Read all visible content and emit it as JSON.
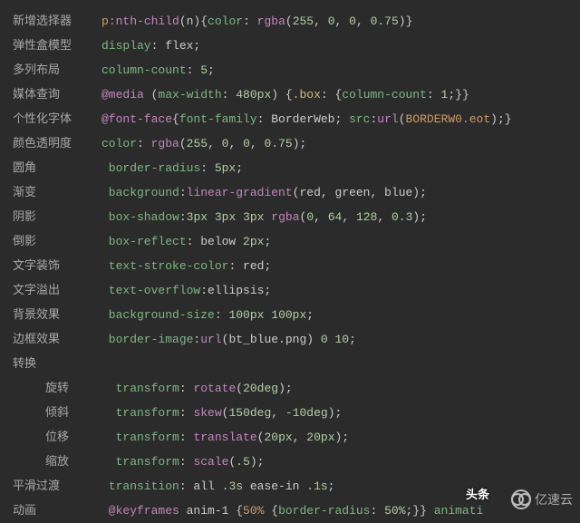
{
  "lines": [
    {
      "label": "新增选择器",
      "indent": false,
      "tokens": [
        {
          "t": "p",
          "c": "c-orange"
        },
        {
          "t": ":nth-child",
          "c": "c-pink"
        },
        {
          "t": "(n){",
          "c": "c-default"
        },
        {
          "t": "color",
          "c": "c-prop"
        },
        {
          "t": ": ",
          "c": "c-default"
        },
        {
          "t": "rgba",
          "c": "c-pink"
        },
        {
          "t": "(",
          "c": "c-default"
        },
        {
          "t": "255",
          "c": "c-num"
        },
        {
          "t": ", ",
          "c": "c-default"
        },
        {
          "t": "0",
          "c": "c-num"
        },
        {
          "t": ", ",
          "c": "c-default"
        },
        {
          "t": "0",
          "c": "c-num"
        },
        {
          "t": ", ",
          "c": "c-default"
        },
        {
          "t": "0.75",
          "c": "c-num"
        },
        {
          "t": ")}",
          "c": "c-default"
        }
      ]
    },
    {
      "label": "弹性盒模型",
      "indent": false,
      "tokens": [
        {
          "t": "display",
          "c": "c-prop"
        },
        {
          "t": ": flex;",
          "c": "c-default"
        }
      ]
    },
    {
      "label": "多列布局",
      "indent": false,
      "tokens": [
        {
          "t": "column-count",
          "c": "c-prop"
        },
        {
          "t": ": ",
          "c": "c-default"
        },
        {
          "t": "5",
          "c": "c-num"
        },
        {
          "t": ";",
          "c": "c-default"
        }
      ]
    },
    {
      "label": "媒体查询",
      "indent": false,
      "tokens": [
        {
          "t": "@media",
          "c": "c-pink"
        },
        {
          "t": " (",
          "c": "c-default"
        },
        {
          "t": "max-width",
          "c": "c-prop"
        },
        {
          "t": ": ",
          "c": "c-default"
        },
        {
          "t": "480px",
          "c": "c-num"
        },
        {
          "t": ") {",
          "c": "c-default"
        },
        {
          "t": ".box",
          "c": "c-yellow"
        },
        {
          "t": ": {",
          "c": "c-default"
        },
        {
          "t": "column-count",
          "c": "c-prop"
        },
        {
          "t": ": ",
          "c": "c-default"
        },
        {
          "t": "1",
          "c": "c-num"
        },
        {
          "t": ";}}",
          "c": "c-default"
        }
      ]
    },
    {
      "label": "个性化字体",
      "indent": false,
      "tokens": [
        {
          "t": "@font-face",
          "c": "c-pink"
        },
        {
          "t": "{",
          "c": "c-default"
        },
        {
          "t": "font-family",
          "c": "c-prop"
        },
        {
          "t": ": BorderWeb; ",
          "c": "c-default"
        },
        {
          "t": "src",
          "c": "c-prop"
        },
        {
          "t": ":",
          "c": "c-default"
        },
        {
          "t": "url",
          "c": "c-pink"
        },
        {
          "t": "(",
          "c": "c-default"
        },
        {
          "t": "BORDERW0.eot",
          "c": "c-orange"
        },
        {
          "t": ");}",
          "c": "c-default"
        }
      ]
    },
    {
      "label": "颜色透明度",
      "indent": false,
      "tokens": [
        {
          "t": "color",
          "c": "c-prop"
        },
        {
          "t": ": ",
          "c": "c-default"
        },
        {
          "t": "rgba",
          "c": "c-pink"
        },
        {
          "t": "(",
          "c": "c-default"
        },
        {
          "t": "255",
          "c": "c-num"
        },
        {
          "t": ", ",
          "c": "c-default"
        },
        {
          "t": "0",
          "c": "c-num"
        },
        {
          "t": ", ",
          "c": "c-default"
        },
        {
          "t": "0",
          "c": "c-num"
        },
        {
          "t": ", ",
          "c": "c-default"
        },
        {
          "t": "0.75",
          "c": "c-num"
        },
        {
          "t": ");",
          "c": "c-default"
        }
      ]
    },
    {
      "label": "圆角",
      "indent": false,
      "tokens": [
        {
          "t": " border-radius",
          "c": "c-prop"
        },
        {
          "t": ": ",
          "c": "c-default"
        },
        {
          "t": "5px",
          "c": "c-num"
        },
        {
          "t": ";",
          "c": "c-default"
        }
      ]
    },
    {
      "label": "渐变",
      "indent": false,
      "tokens": [
        {
          "t": " background",
          "c": "c-prop"
        },
        {
          "t": ":",
          "c": "c-default"
        },
        {
          "t": "linear-gradient",
          "c": "c-pink"
        },
        {
          "t": "(red, green, blue);",
          "c": "c-default"
        }
      ]
    },
    {
      "label": "阴影",
      "indent": false,
      "tokens": [
        {
          "t": " box-shadow",
          "c": "c-prop"
        },
        {
          "t": ":",
          "c": "c-default"
        },
        {
          "t": "3px",
          "c": "c-num"
        },
        {
          "t": " ",
          "c": "c-default"
        },
        {
          "t": "3px",
          "c": "c-num"
        },
        {
          "t": " ",
          "c": "c-default"
        },
        {
          "t": "3px",
          "c": "c-num"
        },
        {
          "t": " ",
          "c": "c-default"
        },
        {
          "t": "rgba",
          "c": "c-pink"
        },
        {
          "t": "(",
          "c": "c-default"
        },
        {
          "t": "0",
          "c": "c-num"
        },
        {
          "t": ", ",
          "c": "c-default"
        },
        {
          "t": "64",
          "c": "c-num"
        },
        {
          "t": ", ",
          "c": "c-default"
        },
        {
          "t": "128",
          "c": "c-num"
        },
        {
          "t": ", ",
          "c": "c-default"
        },
        {
          "t": "0.3",
          "c": "c-num"
        },
        {
          "t": ");",
          "c": "c-default"
        }
      ]
    },
    {
      "label": "倒影",
      "indent": false,
      "tokens": [
        {
          "t": " box-reflect",
          "c": "c-prop"
        },
        {
          "t": ": below ",
          "c": "c-default"
        },
        {
          "t": "2px",
          "c": "c-num"
        },
        {
          "t": ";",
          "c": "c-default"
        }
      ]
    },
    {
      "label": "文字装饰",
      "indent": false,
      "tokens": [
        {
          "t": " text-stroke-color",
          "c": "c-prop"
        },
        {
          "t": ": red;",
          "c": "c-default"
        }
      ]
    },
    {
      "label": "文字溢出",
      "indent": false,
      "tokens": [
        {
          "t": " text-overflow",
          "c": "c-prop"
        },
        {
          "t": ":ellipsis;",
          "c": "c-default"
        }
      ]
    },
    {
      "label": "背景效果",
      "indent": false,
      "tokens": [
        {
          "t": " background-size",
          "c": "c-prop"
        },
        {
          "t": ": ",
          "c": "c-default"
        },
        {
          "t": "100px",
          "c": "c-num"
        },
        {
          "t": " ",
          "c": "c-default"
        },
        {
          "t": "100px",
          "c": "c-num"
        },
        {
          "t": ";",
          "c": "c-default"
        }
      ]
    },
    {
      "label": "边框效果",
      "indent": false,
      "tokens": [
        {
          "t": " border-image",
          "c": "c-prop"
        },
        {
          "t": ":",
          "c": "c-default"
        },
        {
          "t": "url",
          "c": "c-pink"
        },
        {
          "t": "(bt_blue.png) ",
          "c": "c-default"
        },
        {
          "t": "0",
          "c": "c-num"
        },
        {
          "t": " ",
          "c": "c-default"
        },
        {
          "t": "10",
          "c": "c-num"
        },
        {
          "t": ";",
          "c": "c-default"
        }
      ]
    },
    {
      "label": "转换",
      "indent": false,
      "tokens": []
    },
    {
      "label": "旋转",
      "indent": true,
      "tokens": [
        {
          "t": "  transform",
          "c": "c-prop"
        },
        {
          "t": ": ",
          "c": "c-default"
        },
        {
          "t": "rotate",
          "c": "c-pink"
        },
        {
          "t": "(",
          "c": "c-default"
        },
        {
          "t": "20deg",
          "c": "c-num"
        },
        {
          "t": ");",
          "c": "c-default"
        }
      ]
    },
    {
      "label": "倾斜",
      "indent": true,
      "tokens": [
        {
          "t": "  transform",
          "c": "c-prop"
        },
        {
          "t": ": ",
          "c": "c-default"
        },
        {
          "t": "skew",
          "c": "c-pink"
        },
        {
          "t": "(",
          "c": "c-default"
        },
        {
          "t": "150deg",
          "c": "c-num"
        },
        {
          "t": ", ",
          "c": "c-default"
        },
        {
          "t": "-10deg",
          "c": "c-num"
        },
        {
          "t": ");",
          "c": "c-default"
        }
      ]
    },
    {
      "label": "位移",
      "indent": true,
      "tokens": [
        {
          "t": "  transform",
          "c": "c-prop"
        },
        {
          "t": ": ",
          "c": "c-default"
        },
        {
          "t": "translate",
          "c": "c-pink"
        },
        {
          "t": "(",
          "c": "c-default"
        },
        {
          "t": "20px",
          "c": "c-num"
        },
        {
          "t": ", ",
          "c": "c-default"
        },
        {
          "t": "20px",
          "c": "c-num"
        },
        {
          "t": ");",
          "c": "c-default"
        }
      ]
    },
    {
      "label": "缩放",
      "indent": true,
      "tokens": [
        {
          "t": "  transform",
          "c": "c-prop"
        },
        {
          "t": ": ",
          "c": "c-default"
        },
        {
          "t": "scale",
          "c": "c-pink"
        },
        {
          "t": "(",
          "c": "c-default"
        },
        {
          "t": ".5",
          "c": "c-num"
        },
        {
          "t": ");",
          "c": "c-default"
        }
      ]
    },
    {
      "label": "平滑过渡",
      "indent": false,
      "tokens": [
        {
          "t": " transition",
          "c": "c-prop"
        },
        {
          "t": ": all ",
          "c": "c-default"
        },
        {
          "t": ".3s",
          "c": "c-num"
        },
        {
          "t": " ease-in ",
          "c": "c-default"
        },
        {
          "t": ".1s",
          "c": "c-num"
        },
        {
          "t": ";",
          "c": "c-default"
        }
      ]
    },
    {
      "label": "动画",
      "indent": false,
      "tokens": [
        {
          "t": " @keyframes",
          "c": "c-pink"
        },
        {
          "t": " anim-1 {",
          "c": "c-default"
        },
        {
          "t": "50%",
          "c": "c-orange"
        },
        {
          "t": " {",
          "c": "c-default"
        },
        {
          "t": "border-radius",
          "c": "c-prop"
        },
        {
          "t": ": ",
          "c": "c-default"
        },
        {
          "t": "50%",
          "c": "c-num"
        },
        {
          "t": ";}} ",
          "c": "c-default"
        },
        {
          "t": "animati",
          "c": "c-prop"
        }
      ]
    }
  ],
  "watermark_text": "亿速云",
  "toutiao_text": "头条"
}
